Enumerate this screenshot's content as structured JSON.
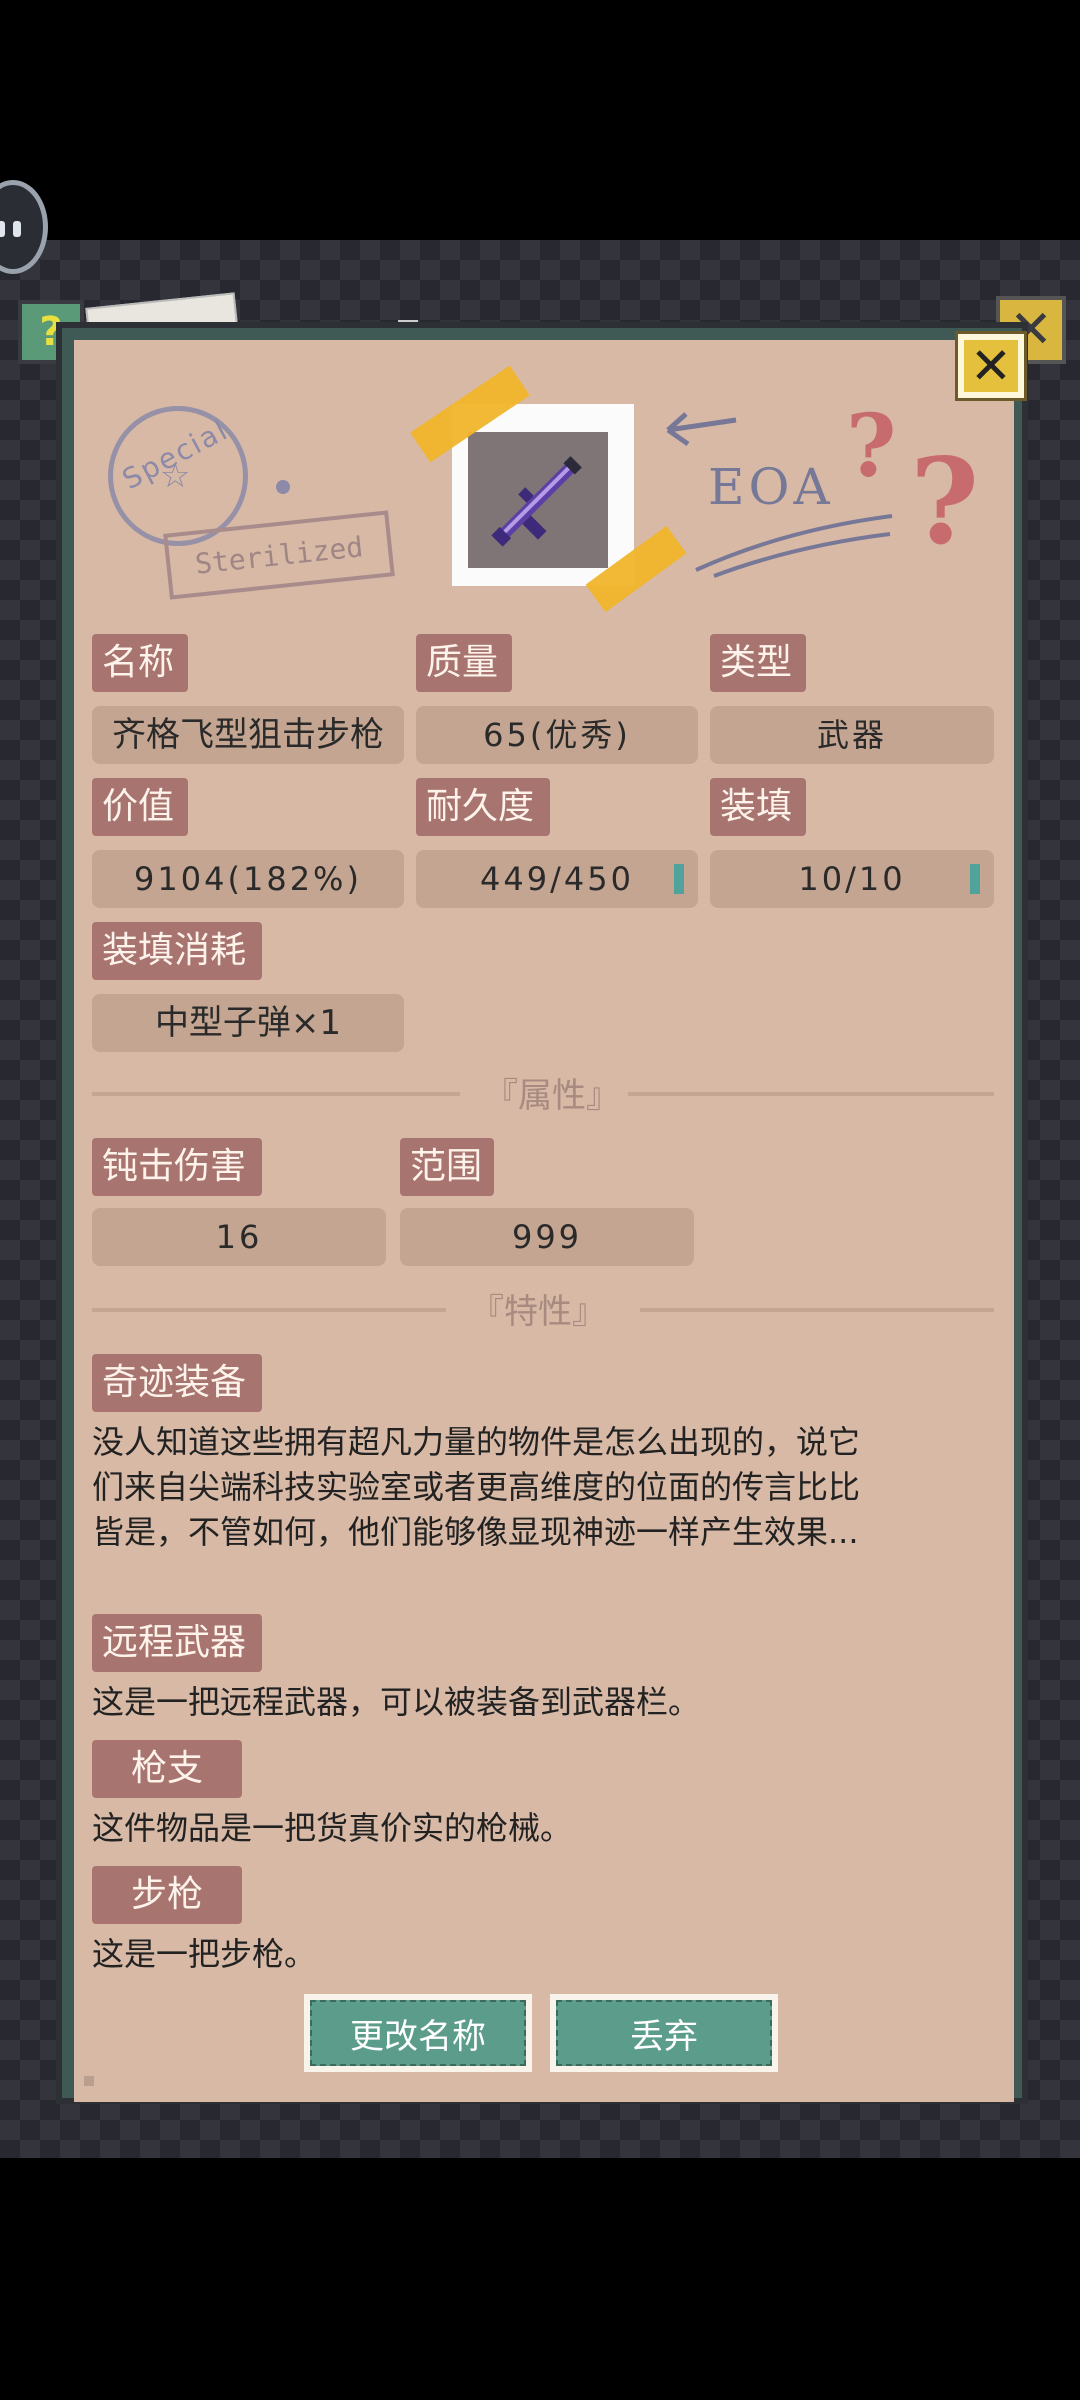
{
  "stamps": {
    "special_text": "Special",
    "sterilized_text": "Sterilized",
    "eoa_text": "EOA"
  },
  "item": {
    "name_label": "名称",
    "name_value": "齐格飞型狙击步枪",
    "quality_label": "质量",
    "quality_value": "65(优秀)",
    "type_label": "类型",
    "type_value": "武器",
    "value_label": "价值",
    "value_value": "9104(182%)",
    "durability_label": "耐久度",
    "durability_value": "449/450",
    "durability_level": 0.998,
    "ammo_label": "装填",
    "ammo_value": "10/10",
    "ammo_level": 1.0,
    "ammo_cost_label": "装填消耗",
    "ammo_cost_value": "中型子弹×1"
  },
  "attributes": {
    "section_title": "『属性』",
    "blunt_label": "钝击伤害",
    "blunt_value": "16",
    "range_label": "范围",
    "range_value": "999"
  },
  "traits": {
    "section_title": "『特性』",
    "items": [
      {
        "label": "奇迹装备",
        "desc_lines": [
          "没人知道这些拥有超凡力量的物件是怎么出现的，说它",
          "们来自尖端科技实验室或者更高维度的位面的传言比比",
          "皆是，不管如何，他们能够像显现神迹一样产生效果..."
        ]
      },
      {
        "label": "远程武器",
        "desc_lines": [
          "这是一把远程武器，可以被装备到武器栏。"
        ]
      },
      {
        "label": "枪支",
        "desc_lines": [
          "这件物品是一把货真价实的枪械。"
        ]
      },
      {
        "label": "步枪",
        "desc_lines": [
          "这是一把步枪。"
        ]
      }
    ]
  },
  "actions": {
    "rename": "更改名称",
    "discard": "丢弃"
  },
  "icons": {
    "close": "close-icon",
    "help": "help-icon",
    "weapon": "purple-rifle-icon"
  },
  "colors": {
    "panel_bg": "#d7b9a6",
    "label_bg": "#a87470",
    "field_bg": "#c4a591",
    "button_green": "#5b9c8a",
    "close_yellow": "#e5c03c",
    "bar_teal": "#4fa39a"
  }
}
